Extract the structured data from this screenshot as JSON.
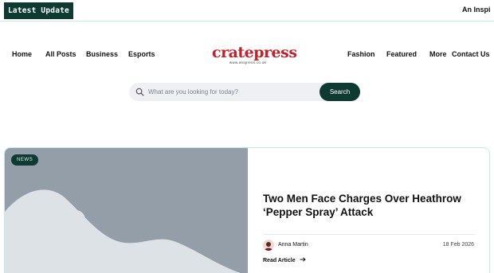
{
  "ticker": {
    "label": "Latest Update",
    "text": "An Inspi"
  },
  "nav": {
    "left": [
      "Home",
      "All Posts",
      "Business",
      "Esports"
    ],
    "right": [
      "Fashion",
      "Featured",
      "More",
      "Contact Us"
    ]
  },
  "logo": {
    "name": "cratepress",
    "url": "www.asspress.co.uk"
  },
  "search": {
    "placeholder": "What are you looking for today?",
    "button": "Search"
  },
  "article": {
    "badge": "NEWS",
    "title": "Two Men Face Charges Over Heathrow ‘Pepper Spray’ Attack",
    "author": "Anna Martin",
    "date": "18 Feb 2026",
    "read_more": "Read Article"
  },
  "colors": {
    "accent": "#0d3b32",
    "border": "#bfeee0",
    "logo": "#c0242b",
    "placeholder_bg": "#939ea8"
  }
}
